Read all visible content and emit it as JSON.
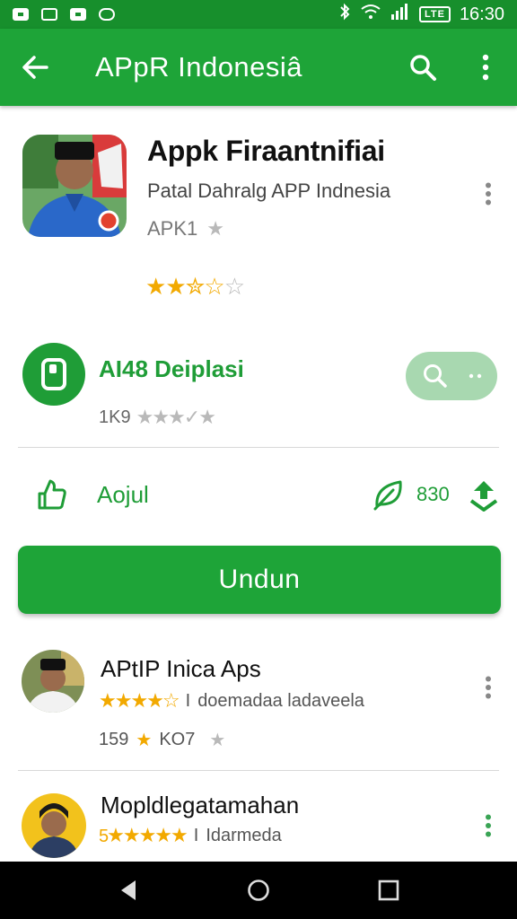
{
  "status_bar": {
    "battery": "LTE",
    "time": "16:30"
  },
  "app_bar": {
    "title": "APpR Indonesiâ"
  },
  "app": {
    "name": "Appk Firaantnifiai",
    "developer": "Patal Dahralg APP Indnesia",
    "apk_label": "APK1",
    "rating_value": 2.5,
    "rating_max": 5
  },
  "downloads": {
    "title": "AI48 Deiplasi",
    "count": "1K9",
    "stars_label": "★★★✓★"
  },
  "actions": {
    "share_label": "Aojul",
    "count": "830"
  },
  "install_button": {
    "label": "Undun"
  },
  "list": [
    {
      "title": "APtIP Inica Aps",
      "rating_text": "★★★★☆",
      "separator": "I",
      "category": "doemadaa ladaveela",
      "count": "159",
      "count_suffix": "KO7"
    },
    {
      "title": "Mopldlegatamahan",
      "rating_text": "★★★★★",
      "rating_prefix": "5",
      "separator": "I",
      "category": "Idarmeda"
    }
  ],
  "colors": {
    "primary_green": "#1ea438",
    "status_green": "#178f2c",
    "star_gold": "#f2a900"
  }
}
